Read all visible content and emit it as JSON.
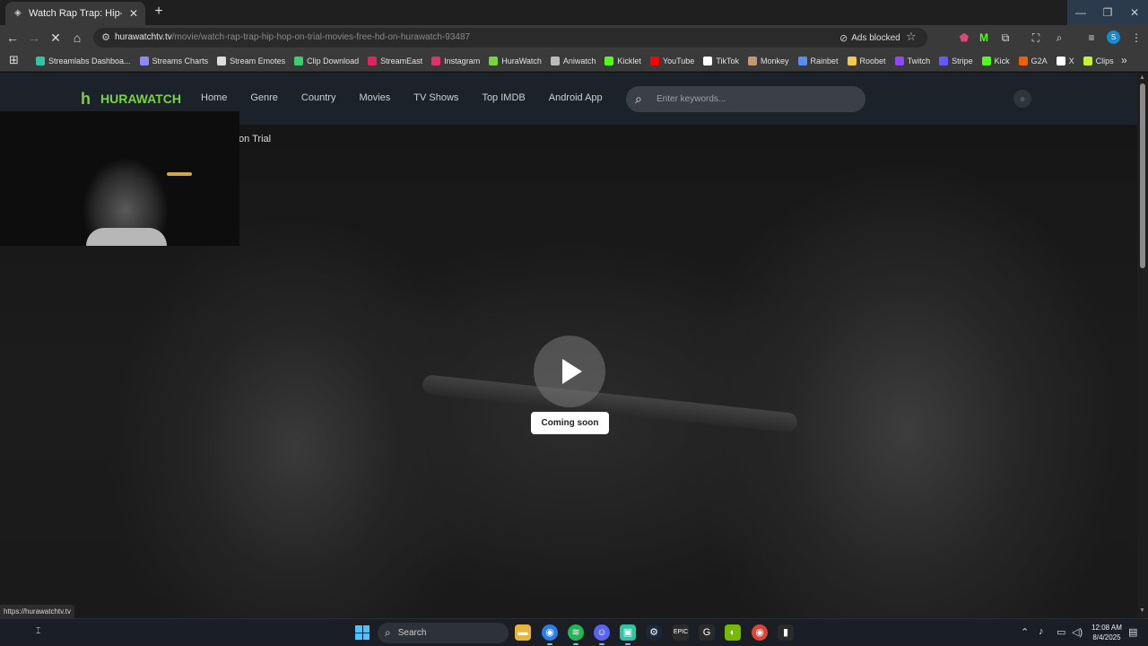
{
  "browser": {
    "tab": {
      "title": "Watch Rap Trap: Hip-Hop on Tr"
    },
    "url": {
      "host": "hurawatchtv.tv",
      "path": "/movie/watch-rap-trap-hip-hop-on-trial-movies-free-hd-on-hurawatch-93487"
    },
    "ads_blocked_label": "Ads blocked",
    "profile_initial": "S",
    "bookmarks": [
      {
        "label": "Streamlabs Dashboa...",
        "color": "#31c3a2"
      },
      {
        "label": "Streams Charts",
        "color": "#8b8bff"
      },
      {
        "label": "Stream Emotes",
        "color": "#dddddd"
      },
      {
        "label": "Clip Download",
        "color": "#3ad16a"
      },
      {
        "label": "StreamEast",
        "color": "#e0245e"
      },
      {
        "label": "Instagram",
        "color": "#e1306c"
      },
      {
        "label": "HuraWatch",
        "color": "#7bd33a"
      },
      {
        "label": "Aniwatch",
        "color": "#bbbbbb"
      },
      {
        "label": "Kicklet",
        "color": "#53fc18"
      },
      {
        "label": "YouTube",
        "color": "#ff0000"
      },
      {
        "label": "TikTok",
        "color": "#ffffff"
      },
      {
        "label": "Monkey",
        "color": "#c49a6c"
      },
      {
        "label": "Rainbet",
        "color": "#5a8dee"
      },
      {
        "label": "Roobet",
        "color": "#f2c94c"
      },
      {
        "label": "Twitch",
        "color": "#9146ff"
      },
      {
        "label": "Stripe",
        "color": "#635bff"
      },
      {
        "label": "Kick",
        "color": "#53fc18"
      },
      {
        "label": "G2A",
        "color": "#f05f00"
      },
      {
        "label": "X",
        "color": "#ffffff"
      },
      {
        "label": "Clips",
        "color": "#c6f135"
      }
    ]
  },
  "site": {
    "logo_text": "HURAWATCH",
    "nav": [
      "Home",
      "Genre",
      "Country",
      "Movies",
      "TV Shows",
      "Top IMDB",
      "Android App"
    ],
    "search_placeholder": "Enter keywords...",
    "breadcrumb_visible": "on Trial",
    "coming_soon": "Coming soon",
    "status_link": "https://hurawatchtv.tv"
  },
  "taskbar": {
    "search_label": "Search",
    "time": "12:08 AM",
    "date": "8/4/2025"
  }
}
